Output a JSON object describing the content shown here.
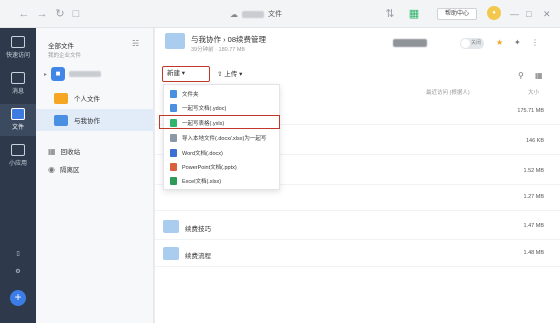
{
  "topbar": {
    "back_icon": "back-arrow-icon",
    "forward_icon": "forward-arrow-icon",
    "refresh_icon": "refresh-icon",
    "title_suffix": "文件",
    "help_label": "帮助中心"
  },
  "darkbar": {
    "items": [
      {
        "label": "快速访问",
        "icon": "quick-access-icon"
      },
      {
        "label": "消息",
        "icon": "message-icon"
      },
      {
        "label": "文件",
        "icon": "file-icon"
      },
      {
        "label": "小应用",
        "icon": "apps-icon"
      }
    ],
    "plus_label": "+"
  },
  "sidebar": {
    "title": "全部文件",
    "subtitle": "我的企业文件",
    "items": [
      {
        "label": "个人文件",
        "color": "#f5a623"
      },
      {
        "label": "与我协作",
        "color": "#4a90e2"
      }
    ],
    "links": [
      {
        "label": "回收站"
      },
      {
        "label": "隔离区"
      }
    ]
  },
  "main": {
    "breadcrumb": "与我协作 › 08续费管理",
    "subinfo": "39分钟前 · 180.77 MB",
    "toggle_label": "关闭",
    "new_label": "新建 ▾",
    "upload_label": "上传 ▾",
    "col_modified": "最近访问 (根据人)",
    "col_size": "大小",
    "rows": [
      {
        "name": "",
        "size": "175.71 MB"
      },
      {
        "name": "",
        "size": "146 KB"
      },
      {
        "name": "",
        "size": "1.52 MB"
      },
      {
        "name": "",
        "size": "1.27 MB"
      },
      {
        "name": "续费技巧",
        "size": "1.47 MB"
      },
      {
        "name": "续费流程",
        "size": "1.48 MB"
      }
    ]
  },
  "dropdown": {
    "items": [
      {
        "label": "文件夹",
        "color": "#4a90e2"
      },
      {
        "label": "一起写文档(.ydoc)",
        "color": "#4a90e2"
      },
      {
        "label": "一起写表格(.yxls)",
        "color": "#2fb66b"
      },
      {
        "label": "导入本地文件(.docx/.xlsx)为一起写",
        "color": "#8c98a6"
      },
      {
        "label": "Word文档(.docx)",
        "color": "#3b6fd4"
      },
      {
        "label": "PowerPoint文档(.pptx)",
        "color": "#d9603b"
      },
      {
        "label": "Excel文档(.xlsx)",
        "color": "#2e9a57"
      }
    ]
  }
}
